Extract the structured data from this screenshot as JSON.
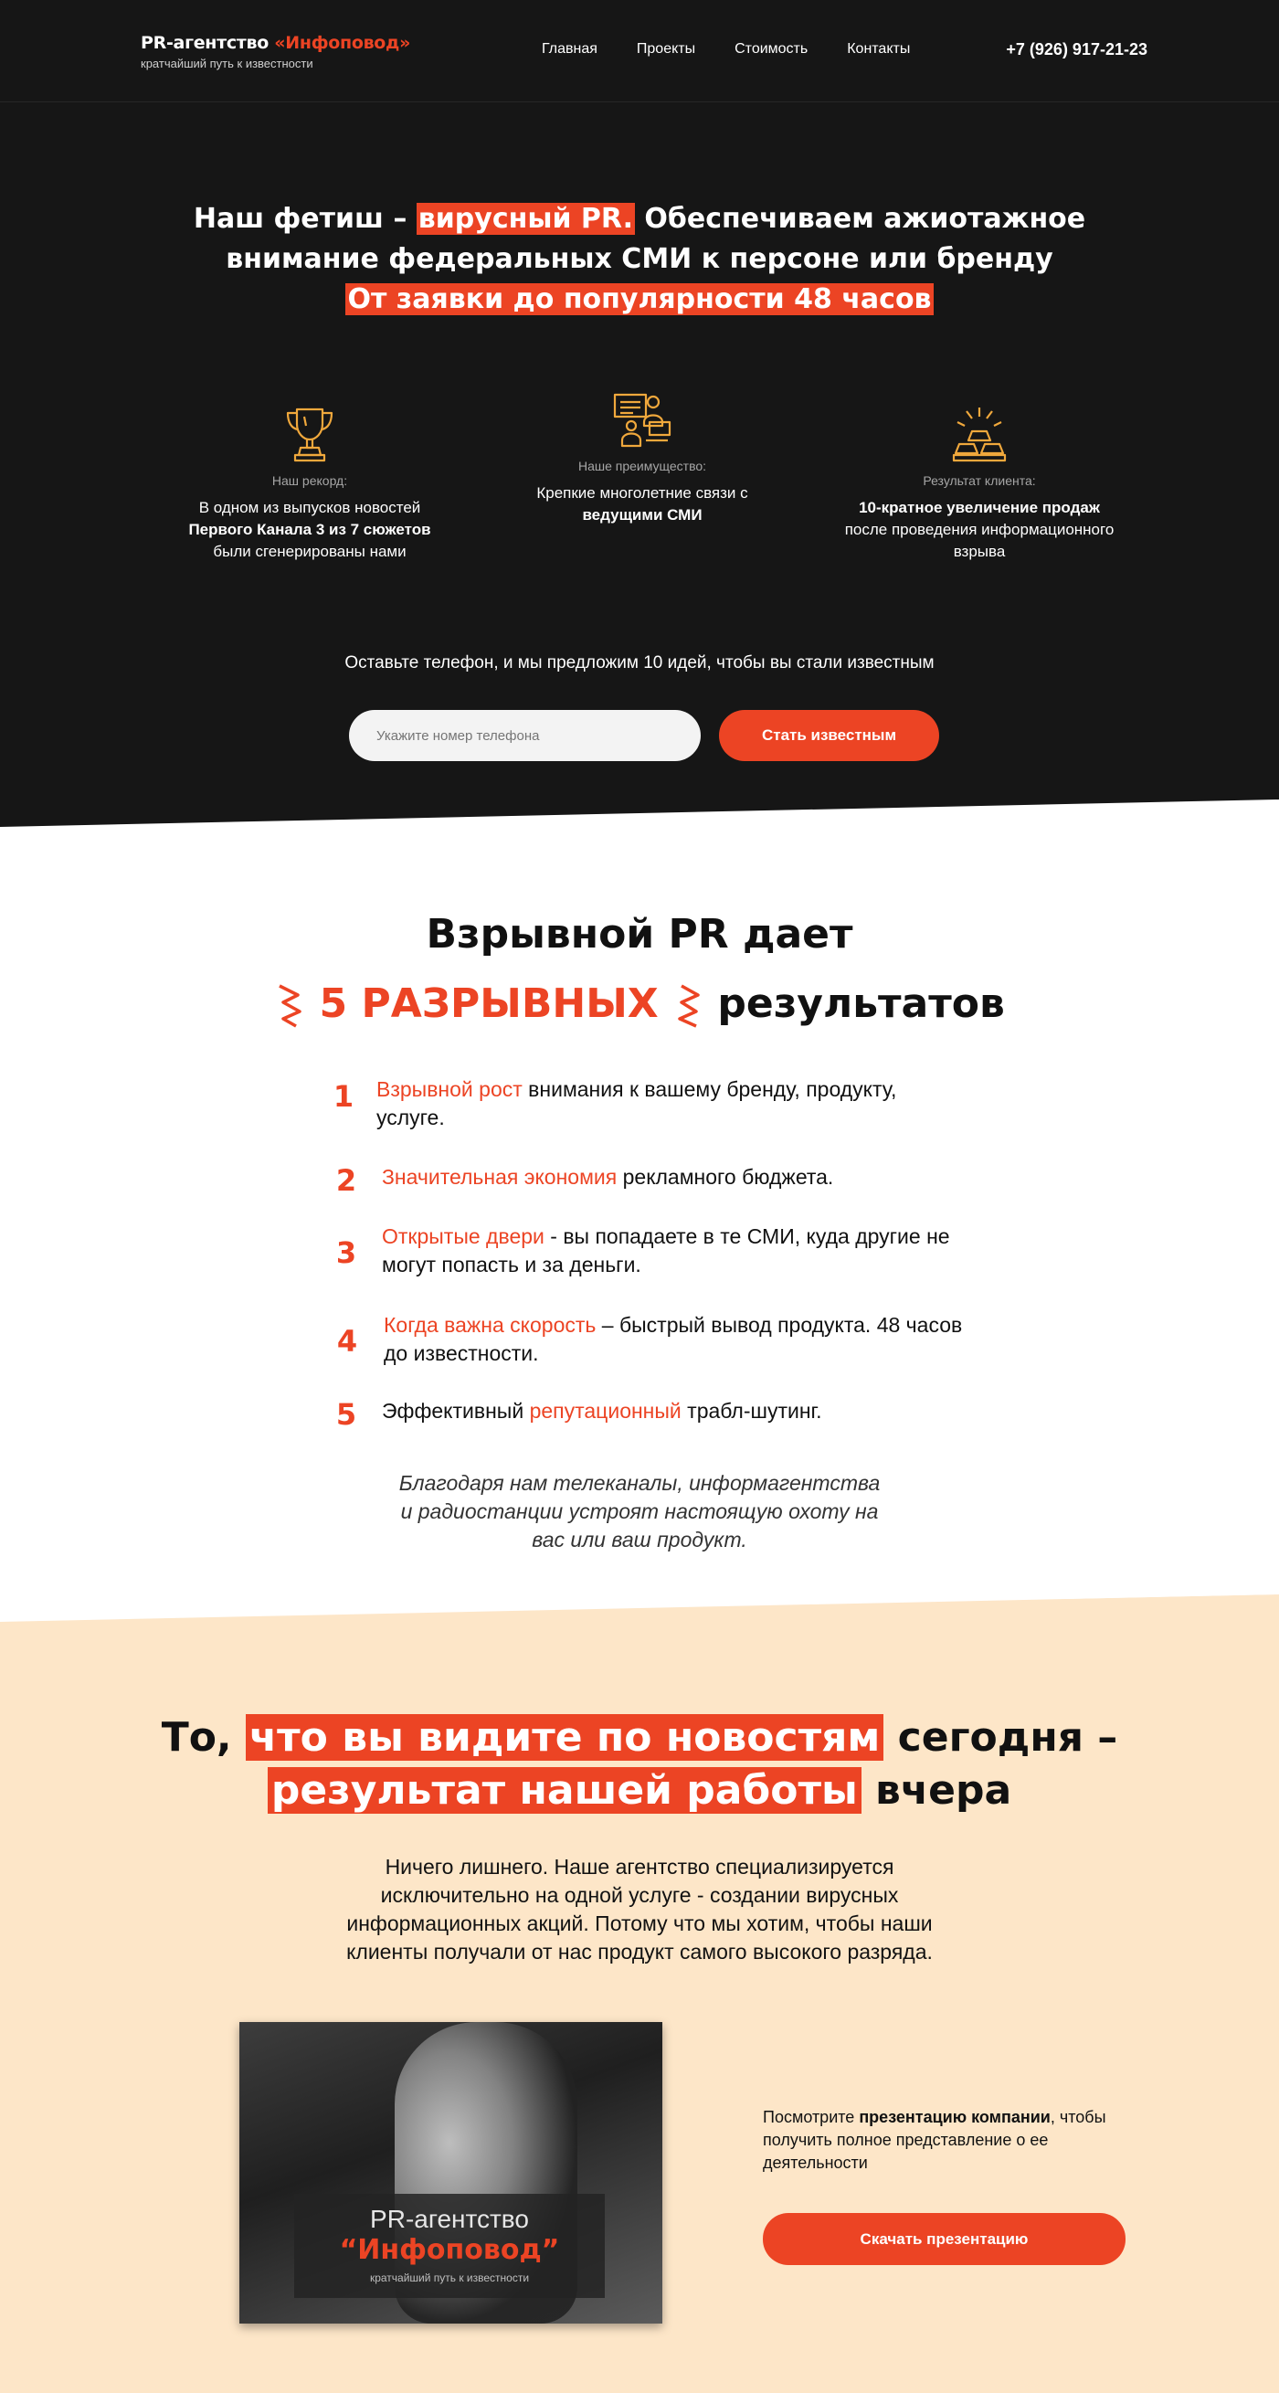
{
  "header": {
    "logo_prefix": "PR-агентство",
    "logo_name": "«Инфоповод»",
    "logo_tagline": "кратчайший путь к известности",
    "nav": [
      {
        "label": "Главная"
      },
      {
        "label": "Проекты"
      },
      {
        "label": "Стоимость"
      },
      {
        "label": "Контакты"
      }
    ],
    "phone": "+7 (926) 917-21-23"
  },
  "hero": {
    "line1_a": "Наш фетиш – ",
    "line1_hl": "вирусный PR.",
    "line1_b": " Обеспечиваем ажиотажное",
    "line2": "внимание федеральных СМИ к персоне или бренду",
    "line3_hl": "От заявки до популярности 48 часов",
    "features": [
      {
        "icon": "trophy-icon",
        "label": "Наш рекорд:",
        "text_a": "В одном из выпусков новостей",
        "text_bold": "Первого Канала 3 из 7 сюжетов",
        "text_b": "были сгенерированы нами"
      },
      {
        "icon": "press-conference-icon",
        "label": "Наше преимущество:",
        "text_a": "Крепкие многолетние связи с",
        "text_bold": "ведущими СМИ",
        "text_b": ""
      },
      {
        "icon": "gold-bars-icon",
        "label": "Результат клиента:",
        "text_bold": "10-кратное увеличение продаж",
        "text_b": " после проведения информационного взрыва"
      }
    ],
    "cta_text": "Оставьте телефон, и мы предложим 10 идей, чтобы вы стали известным",
    "phone_placeholder": "Укажите номер телефона",
    "cta_button": "Стать известным"
  },
  "results": {
    "title_line1": "Взрывной PR дает",
    "title_red": "5 РАЗРЫВНЫХ",
    "title_rest": "результатов",
    "items": [
      {
        "num": "1",
        "red": "Взрывной рост",
        "text": " внимания к вашему бренду, продукту, услуге."
      },
      {
        "num": "2",
        "red": "Значительная экономия",
        "text": " рекламного бюджета."
      },
      {
        "num": "3",
        "red": "Открытые двери",
        "text": " - вы попадаете в те СМИ, куда другие не могут попасть и за деньги."
      },
      {
        "num": "4",
        "red": "Когда важна скорость",
        "text": " – быстрый вывод продукта. 48 часов до известности."
      },
      {
        "num": "5",
        "pre": "Эффективный ",
        "red": "репутационный",
        "text": " трабл-шутинг."
      }
    ],
    "note": "Благодаря нам телеканалы, информагентства и радиостанции устроят настоящую охоту на вас или ваш продукт."
  },
  "news": {
    "title_a": "То, ",
    "title_hl1": "что вы видите по новостям",
    "title_b": " сегодня –",
    "title_hl2": "результат нашей работы",
    "title_c": " вчера",
    "description": "Ничего лишнего. Наше агентство специализируется исключительно на одной услуге - создании вирусных информационных акций. Потому что мы хотим, чтобы наши клиенты получали от нас продукт самого высокого разряда.",
    "booklet_title": "PR-агентство",
    "booklet_name": "“Инфоповод”",
    "booklet_tagline": "кратчайший путь к известности",
    "present_a": "Посмотрите ",
    "present_bold": "презентацию компании",
    "present_b": ", чтобы получить полное представление о ее деятельности",
    "present_button": "Скачать презентацию"
  },
  "colors": {
    "accent": "#ec4424",
    "dark_bg": "#161616",
    "peach_bg": "#fde6c8",
    "icon_gold": "#f0a83c"
  }
}
